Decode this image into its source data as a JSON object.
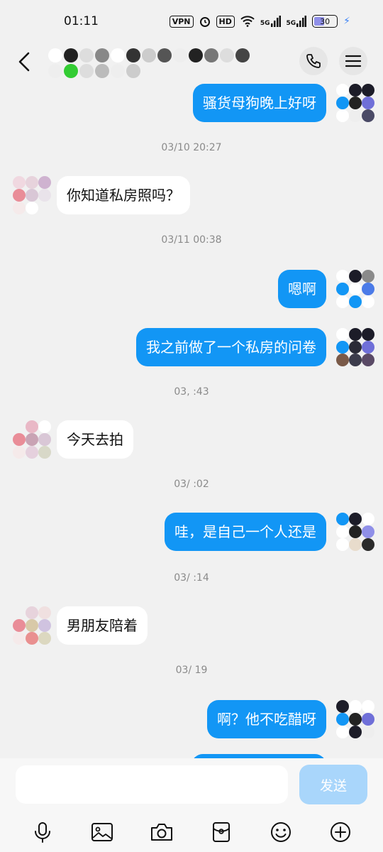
{
  "status_bar": {
    "time": "01:11",
    "vpn": "VPN",
    "hd": "HD",
    "net1": "5G",
    "net2": "5G",
    "battery": "30"
  },
  "header": {
    "contact_name": "",
    "call_icon": "phone-icon",
    "menu_icon": "menu-icon"
  },
  "messages": [
    {
      "type": "out",
      "text": "骚货母狗晚上好呀"
    },
    {
      "type": "time",
      "text": "03/10 20:27"
    },
    {
      "type": "in",
      "text": "你知道私房照吗？"
    },
    {
      "type": "time",
      "text": "03/11 00:38"
    },
    {
      "type": "out",
      "text": "嗯啊"
    },
    {
      "type": "out",
      "text": "我之前做了一个私房的问卷"
    },
    {
      "type": "time",
      "text": "03,   :43"
    },
    {
      "type": "in",
      "text": "今天去拍"
    },
    {
      "type": "time",
      "text": "03/   :02"
    },
    {
      "type": "out",
      "text": "哇，是自己一个人还是"
    },
    {
      "type": "time",
      "text": "03/   :14"
    },
    {
      "type": "in",
      "text": "男朋友陪着"
    },
    {
      "type": "time",
      "text": "03/   19"
    },
    {
      "type": "out",
      "text": "啊？他不吃醋呀"
    }
  ],
  "input": {
    "placeholder": "",
    "send_label": "发送"
  },
  "toolbar": [
    "mic-icon",
    "image-icon",
    "camera-icon",
    "red-packet-icon",
    "emoji-icon",
    "plus-icon"
  ],
  "colors": {
    "outgoing_bubble": "#1296f5",
    "incoming_bubble": "#ffffff",
    "background": "#f1f1f1",
    "send_button": "#a9d6fb"
  }
}
